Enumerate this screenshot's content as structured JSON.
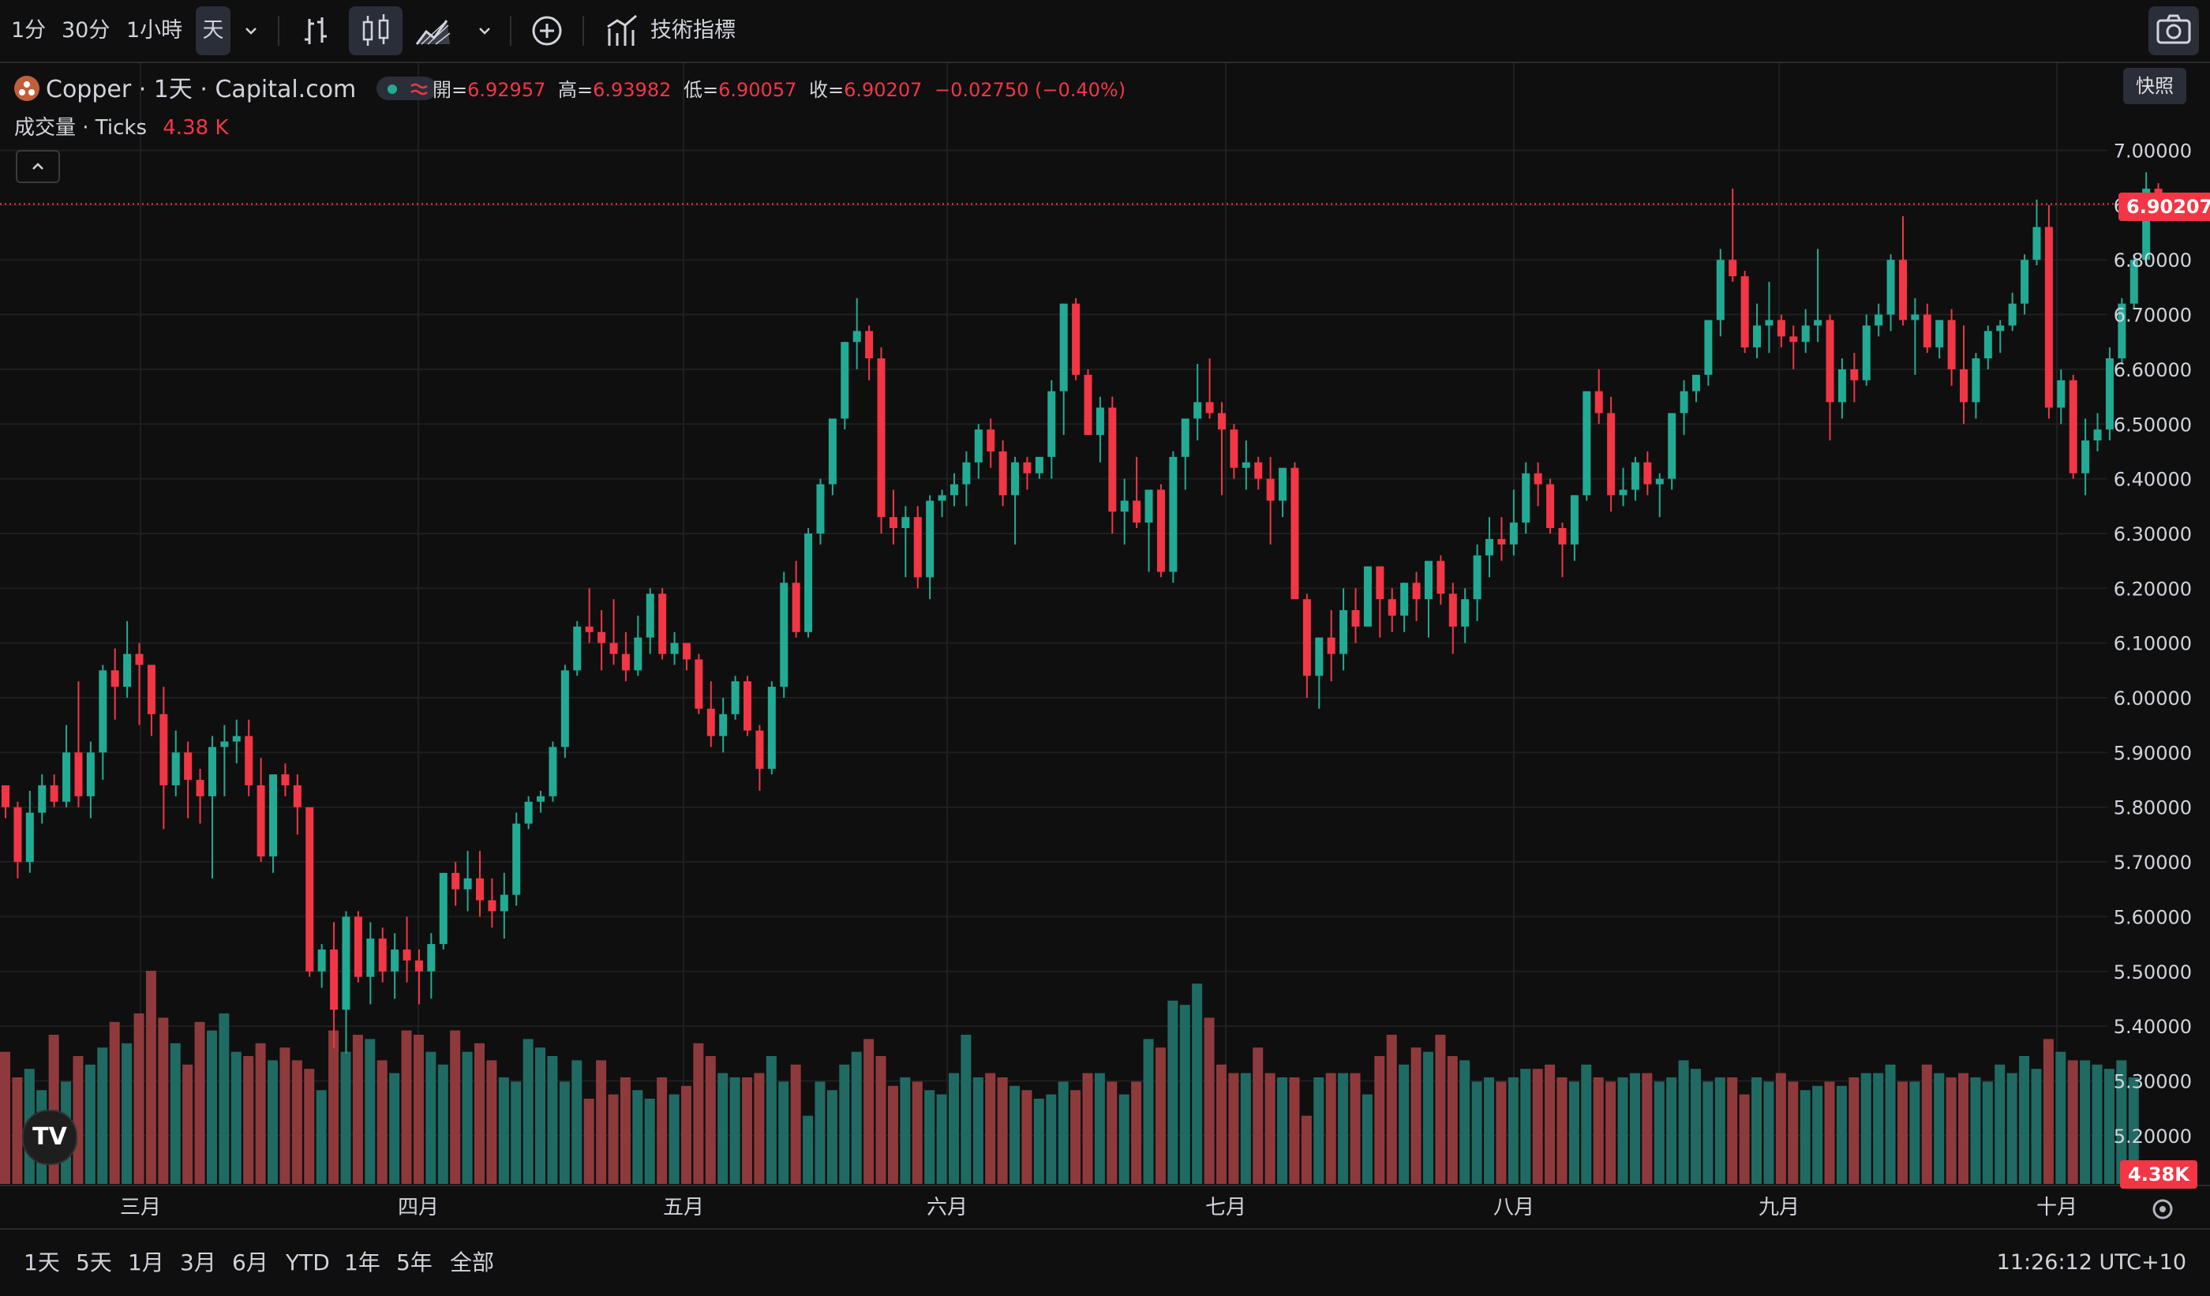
{
  "toolbar": {
    "intervals": [
      "1分",
      "30分",
      "1小時",
      "天"
    ],
    "indicators_label": "技術指標",
    "snapshot_tooltip": "快照"
  },
  "legend": {
    "title": "Copper · 1天 · Capital.com",
    "open_label": "開=",
    "open": "6.92957",
    "high_label": "高=",
    "high": "6.93982",
    "low_label": "低=",
    "low": "6.90057",
    "close_label": "收=",
    "close": "6.90207",
    "change": "−0.02750 (−0.40%)",
    "volume_label": "成交量 · Ticks",
    "volume_value": "4.38 K"
  },
  "last_price_badge": "6.90207",
  "last_volume_badge": "4.38K",
  "logo_text": "TV",
  "ranges": [
    "1天",
    "5天",
    "1月",
    "3月",
    "6月",
    "YTD",
    "1年",
    "5年",
    "全部"
  ],
  "clock": "11:26:12 UTC+10",
  "colors": {
    "up": "#22ab94",
    "down": "#f23645",
    "up_vol": "#1f6b63",
    "down_vol": "#8e3a3c",
    "background": "#0f0f0f",
    "grid": "#1f1f1f"
  },
  "chart_data": {
    "type": "candlestick",
    "symbol": "Copper",
    "interval": "1天",
    "source": "Capital.com",
    "y_ticks": [
      "7.00000",
      "6.90000",
      "6.80000",
      "6.70000",
      "6.60000",
      "6.50000",
      "6.40000",
      "6.30000",
      "6.20000",
      "6.10000",
      "6.00000",
      "5.90000",
      "5.80000",
      "5.70000",
      "5.60000",
      "5.50000",
      "5.40000",
      "5.30000",
      "5.20000"
    ],
    "ylim": [
      5.15,
      7.1
    ],
    "x_labels": [
      "三月",
      "四月",
      "五月",
      "六月",
      "七月",
      "八月",
      "九月",
      "十月"
    ],
    "start_date": "2025-02-21",
    "candles": [
      [
        5.84,
        5.84,
        5.78,
        5.8
      ],
      [
        5.8,
        5.81,
        5.67,
        5.7
      ],
      [
        5.7,
        5.83,
        5.68,
        5.79
      ],
      [
        5.79,
        5.86,
        5.77,
        5.84
      ],
      [
        5.84,
        5.86,
        5.8,
        5.81
      ],
      [
        5.81,
        5.95,
        5.8,
        5.9
      ],
      [
        5.9,
        6.03,
        5.8,
        5.82
      ],
      [
        5.82,
        5.92,
        5.78,
        5.9
      ],
      [
        5.9,
        6.06,
        5.85,
        6.05
      ],
      [
        6.05,
        6.09,
        5.96,
        6.02
      ],
      [
        6.02,
        6.14,
        6.0,
        6.08
      ],
      [
        6.08,
        6.1,
        5.95,
        6.06
      ],
      [
        6.06,
        6.06,
        5.93,
        5.97
      ],
      [
        5.97,
        6.02,
        5.76,
        5.84
      ],
      [
        5.84,
        5.94,
        5.82,
        5.9
      ],
      [
        5.9,
        5.92,
        5.78,
        5.85
      ],
      [
        5.85,
        5.87,
        5.77,
        5.82
      ],
      [
        5.82,
        5.93,
        5.67,
        5.91
      ],
      [
        5.91,
        5.95,
        5.82,
        5.92
      ],
      [
        5.92,
        5.96,
        5.88,
        5.93
      ],
      [
        5.93,
        5.96,
        5.82,
        5.84
      ],
      [
        5.84,
        5.89,
        5.7,
        5.71
      ],
      [
        5.71,
        5.85,
        5.68,
        5.86
      ],
      [
        5.86,
        5.88,
        5.82,
        5.84
      ],
      [
        5.84,
        5.86,
        5.75,
        5.8
      ],
      [
        5.8,
        5.8,
        5.49,
        5.5
      ],
      [
        5.5,
        5.55,
        5.47,
        5.54
      ],
      [
        5.54,
        5.59,
        5.36,
        5.43
      ],
      [
        5.43,
        5.61,
        5.35,
        5.6
      ],
      [
        5.6,
        5.61,
        5.48,
        5.49
      ],
      [
        5.49,
        5.59,
        5.44,
        5.56
      ],
      [
        5.56,
        5.58,
        5.48,
        5.5
      ],
      [
        5.5,
        5.57,
        5.45,
        5.54
      ],
      [
        5.54,
        5.6,
        5.48,
        5.52
      ],
      [
        5.52,
        5.54,
        5.44,
        5.5
      ],
      [
        5.5,
        5.57,
        5.45,
        5.55
      ],
      [
        5.55,
        5.68,
        5.54,
        5.68
      ],
      [
        5.68,
        5.7,
        5.62,
        5.65
      ],
      [
        5.65,
        5.72,
        5.61,
        5.67
      ],
      [
        5.67,
        5.72,
        5.6,
        5.63
      ],
      [
        5.63,
        5.67,
        5.58,
        5.61
      ],
      [
        5.61,
        5.68,
        5.56,
        5.64
      ],
      [
        5.64,
        5.79,
        5.62,
        5.77
      ],
      [
        5.77,
        5.82,
        5.76,
        5.81
      ],
      [
        5.81,
        5.83,
        5.79,
        5.82
      ],
      [
        5.82,
        5.92,
        5.81,
        5.91
      ],
      [
        5.91,
        6.06,
        5.89,
        6.05
      ],
      [
        6.05,
        6.14,
        6.04,
        6.13
      ],
      [
        6.13,
        6.2,
        6.1,
        6.12
      ],
      [
        6.12,
        6.16,
        6.05,
        6.1
      ],
      [
        6.1,
        6.18,
        6.06,
        6.08
      ],
      [
        6.08,
        6.12,
        6.03,
        6.05
      ],
      [
        6.05,
        6.15,
        6.04,
        6.11
      ],
      [
        6.11,
        6.2,
        6.08,
        6.19
      ],
      [
        6.19,
        6.2,
        6.07,
        6.08
      ],
      [
        6.08,
        6.12,
        6.06,
        6.1
      ],
      [
        6.1,
        6.1,
        6.05,
        6.07
      ],
      [
        6.07,
        6.08,
        5.97,
        5.98
      ],
      [
        5.98,
        6.03,
        5.91,
        5.93
      ],
      [
        5.93,
        6.0,
        5.9,
        5.97
      ],
      [
        5.97,
        6.04,
        5.96,
        6.03
      ],
      [
        6.03,
        6.04,
        5.93,
        5.94
      ],
      [
        5.94,
        5.95,
        5.83,
        5.87
      ],
      [
        5.87,
        6.03,
        5.86,
        6.02
      ],
      [
        6.02,
        6.23,
        6.0,
        6.21
      ],
      [
        6.21,
        6.25,
        6.11,
        6.12
      ],
      [
        6.12,
        6.31,
        6.11,
        6.3
      ],
      [
        6.3,
        6.4,
        6.28,
        6.39
      ],
      [
        6.39,
        6.5,
        6.37,
        6.51
      ],
      [
        6.51,
        6.65,
        6.49,
        6.65
      ],
      [
        6.65,
        6.73,
        6.6,
        6.67
      ],
      [
        6.67,
        6.68,
        6.58,
        6.62
      ],
      [
        6.62,
        6.64,
        6.3,
        6.33
      ],
      [
        6.33,
        6.38,
        6.28,
        6.31
      ],
      [
        6.31,
        6.35,
        6.22,
        6.33
      ],
      [
        6.33,
        6.35,
        6.2,
        6.22
      ],
      [
        6.22,
        6.37,
        6.18,
        6.36
      ],
      [
        6.36,
        6.38,
        6.33,
        6.37
      ],
      [
        6.37,
        6.41,
        6.35,
        6.39
      ],
      [
        6.39,
        6.45,
        6.35,
        6.43
      ],
      [
        6.43,
        6.5,
        6.4,
        6.49
      ],
      [
        6.49,
        6.51,
        6.42,
        6.45
      ],
      [
        6.45,
        6.47,
        6.35,
        6.37
      ],
      [
        6.37,
        6.44,
        6.28,
        6.43
      ],
      [
        6.43,
        6.44,
        6.38,
        6.41
      ],
      [
        6.41,
        6.44,
        6.4,
        6.44
      ],
      [
        6.44,
        6.58,
        6.4,
        6.56
      ],
      [
        6.56,
        6.72,
        6.48,
        6.72
      ],
      [
        6.72,
        6.73,
        6.58,
        6.59
      ],
      [
        6.59,
        6.6,
        6.48,
        6.48
      ],
      [
        6.48,
        6.55,
        6.43,
        6.53
      ],
      [
        6.53,
        6.55,
        6.3,
        6.34
      ],
      [
        6.34,
        6.4,
        6.28,
        6.36
      ],
      [
        6.36,
        6.44,
        6.31,
        6.32
      ],
      [
        6.32,
        6.35,
        6.23,
        6.38
      ],
      [
        6.38,
        6.39,
        6.22,
        6.23
      ],
      [
        6.23,
        6.45,
        6.21,
        6.44
      ],
      [
        6.44,
        6.46,
        6.38,
        6.51
      ],
      [
        6.51,
        6.61,
        6.47,
        6.54
      ],
      [
        6.54,
        6.62,
        6.51,
        6.52
      ],
      [
        6.52,
        6.54,
        6.37,
        6.49
      ],
      [
        6.49,
        6.5,
        6.4,
        6.42
      ],
      [
        6.42,
        6.47,
        6.38,
        6.43
      ],
      [
        6.43,
        6.44,
        6.38,
        6.4
      ],
      [
        6.4,
        6.44,
        6.28,
        6.36
      ],
      [
        6.36,
        6.42,
        6.33,
        6.42
      ],
      [
        6.42,
        6.43,
        6.18,
        6.18
      ],
      [
        6.18,
        6.19,
        6.0,
        6.04
      ],
      [
        6.04,
        6.11,
        5.98,
        6.11
      ],
      [
        6.11,
        6.16,
        6.03,
        6.08
      ],
      [
        6.08,
        6.2,
        6.05,
        6.16
      ],
      [
        6.16,
        6.2,
        6.1,
        6.13
      ],
      [
        6.13,
        6.24,
        6.13,
        6.24
      ],
      [
        6.24,
        6.24,
        6.11,
        6.18
      ],
      [
        6.18,
        6.2,
        6.12,
        6.15
      ],
      [
        6.15,
        6.21,
        6.12,
        6.21
      ],
      [
        6.21,
        6.23,
        6.14,
        6.18
      ],
      [
        6.18,
        6.24,
        6.11,
        6.25
      ],
      [
        6.25,
        6.26,
        6.17,
        6.19
      ],
      [
        6.19,
        6.21,
        6.08,
        6.13
      ],
      [
        6.13,
        6.2,
        6.1,
        6.18
      ],
      [
        6.18,
        6.28,
        6.14,
        6.26
      ],
      [
        6.26,
        6.33,
        6.22,
        6.29
      ],
      [
        6.29,
        6.33,
        6.25,
        6.28
      ],
      [
        6.28,
        6.38,
        6.26,
        6.32
      ],
      [
        6.32,
        6.43,
        6.3,
        6.41
      ],
      [
        6.41,
        6.43,
        6.35,
        6.39
      ],
      [
        6.39,
        6.4,
        6.3,
        6.31
      ],
      [
        6.31,
        6.32,
        6.22,
        6.28
      ],
      [
        6.28,
        6.37,
        6.25,
        6.37
      ],
      [
        6.37,
        6.55,
        6.36,
        6.56
      ],
      [
        6.56,
        6.6,
        6.5,
        6.52
      ],
      [
        6.52,
        6.55,
        6.34,
        6.37
      ],
      [
        6.37,
        6.42,
        6.35,
        6.38
      ],
      [
        6.38,
        6.44,
        6.36,
        6.43
      ],
      [
        6.43,
        6.45,
        6.37,
        6.39
      ],
      [
        6.39,
        6.41,
        6.33,
        6.4
      ],
      [
        6.4,
        6.52,
        6.38,
        6.52
      ],
      [
        6.52,
        6.58,
        6.48,
        6.56
      ],
      [
        6.56,
        6.58,
        6.54,
        6.59
      ],
      [
        6.59,
        6.68,
        6.57,
        6.69
      ],
      [
        6.69,
        6.82,
        6.66,
        6.8
      ],
      [
        6.8,
        6.93,
        6.76,
        6.77
      ],
      [
        6.77,
        6.78,
        6.63,
        6.64
      ],
      [
        6.64,
        6.72,
        6.62,
        6.68
      ],
      [
        6.68,
        6.76,
        6.63,
        6.69
      ],
      [
        6.69,
        6.7,
        6.64,
        6.66
      ],
      [
        6.66,
        6.68,
        6.6,
        6.65
      ],
      [
        6.65,
        6.71,
        6.63,
        6.68
      ],
      [
        6.68,
        6.82,
        6.65,
        6.69
      ],
      [
        6.69,
        6.7,
        6.47,
        6.54
      ],
      [
        6.54,
        6.62,
        6.51,
        6.6
      ],
      [
        6.6,
        6.63,
        6.54,
        6.58
      ],
      [
        6.58,
        6.7,
        6.57,
        6.68
      ],
      [
        6.68,
        6.72,
        6.66,
        6.7
      ],
      [
        6.7,
        6.81,
        6.67,
        6.8
      ],
      [
        6.8,
        6.88,
        6.68,
        6.69
      ],
      [
        6.69,
        6.73,
        6.59,
        6.7
      ],
      [
        6.7,
        6.72,
        6.63,
        6.64
      ],
      [
        6.64,
        6.69,
        6.62,
        6.69
      ],
      [
        6.69,
        6.71,
        6.57,
        6.6
      ],
      [
        6.6,
        6.68,
        6.5,
        6.54
      ],
      [
        6.54,
        6.63,
        6.51,
        6.62
      ],
      [
        6.62,
        6.68,
        6.6,
        6.67
      ],
      [
        6.67,
        6.69,
        6.63,
        6.68
      ],
      [
        6.68,
        6.74,
        6.67,
        6.72
      ],
      [
        6.72,
        6.81,
        6.7,
        6.8
      ],
      [
        6.8,
        6.91,
        6.79,
        6.86
      ],
      [
        6.86,
        6.9,
        6.51,
        6.53
      ],
      [
        6.53,
        6.6,
        6.5,
        6.58
      ],
      [
        6.58,
        6.59,
        6.4,
        6.41
      ],
      [
        6.41,
        6.51,
        6.37,
        6.47
      ],
      [
        6.47,
        6.52,
        6.45,
        6.49
      ],
      [
        6.49,
        6.64,
        6.47,
        6.62
      ],
      [
        6.62,
        6.73,
        6.61,
        6.72
      ],
      [
        6.72,
        6.81,
        6.71,
        6.8
      ],
      [
        6.8,
        6.96,
        6.79,
        6.93
      ],
      [
        6.93,
        6.94,
        6.9,
        6.9
      ]
    ],
    "volumes": [
      3.1,
      2.5,
      2.7,
      2.2,
      3.5,
      2.4,
      3.0,
      2.8,
      3.2,
      3.8,
      3.3,
      4.0,
      5.0,
      3.9,
      3.3,
      2.8,
      3.8,
      3.6,
      4.0,
      3.1,
      3.0,
      3.3,
      2.9,
      3.2,
      2.9,
      2.7,
      2.2,
      3.6,
      3.1,
      3.5,
      3.4,
      2.9,
      2.6,
      3.6,
      3.5,
      3.1,
      2.8,
      3.6,
      3.1,
      3.3,
      2.9,
      2.5,
      2.4,
      3.4,
      3.2,
      3.0,
      2.4,
      2.9,
      2.0,
      2.9,
      2.1,
      2.5,
      2.2,
      2.0,
      2.5,
      2.1,
      2.3,
      3.3,
      3.0,
      2.6,
      2.5,
      2.5,
      2.6,
      3.0,
      2.4,
      2.8,
      1.6,
      2.4,
      2.2,
      2.8,
      3.1,
      3.4,
      3.0,
      2.3,
      2.5,
      2.4,
      2.2,
      2.1,
      2.6,
      3.5,
      2.5,
      2.6,
      2.5,
      2.3,
      2.2,
      2.0,
      2.1,
      2.4,
      2.2,
      2.6,
      2.6,
      2.4,
      2.1,
      2.4,
      3.4,
      3.2,
      4.3,
      4.2,
      4.7,
      3.9,
      2.8,
      2.6,
      2.6,
      3.2,
      2.6,
      2.5,
      2.5,
      1.6,
      2.5,
      2.6,
      2.6,
      2.6,
      2.1,
      3.0,
      3.5,
      2.8,
      3.2,
      3.1,
      3.5,
      3.0,
      2.9,
      2.4,
      2.5,
      2.4,
      2.5,
      2.7,
      2.7,
      2.8,
      2.5,
      2.4,
      2.8,
      2.5,
      2.4,
      2.5,
      2.6,
      2.6,
      2.4,
      2.5,
      2.9,
      2.7,
      2.4,
      2.5,
      2.5,
      2.1,
      2.5,
      2.4,
      2.6,
      2.4,
      2.2,
      2.3,
      2.4,
      2.3,
      2.5,
      2.6,
      2.6,
      2.8,
      2.4,
      2.4,
      2.8,
      2.6,
      2.5,
      2.6,
      2.5,
      2.4,
      2.8,
      2.6,
      3.0,
      2.7,
      3.4,
      3.1,
      2.9,
      2.9,
      2.8,
      2.7,
      2.9,
      2.5,
      0.2
    ],
    "vol_max": 5.0,
    "last_price": 6.90207
  }
}
